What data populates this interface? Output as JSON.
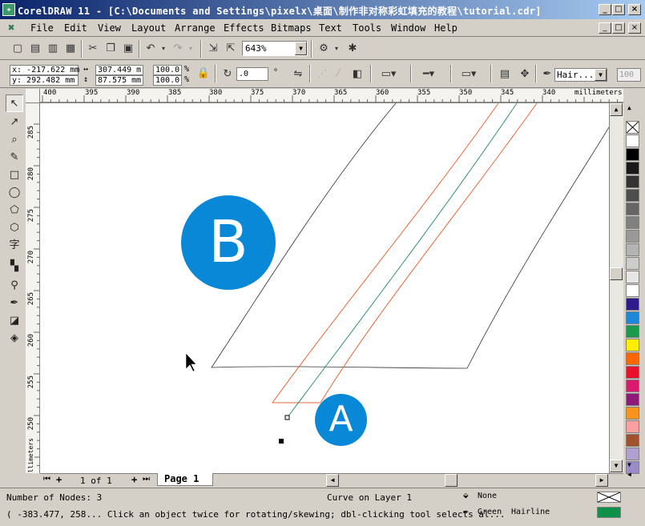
{
  "window": {
    "title": "CorelDRAW 11 - [C:\\Documents and Settings\\pixelx\\桌面\\制作非对称彩虹填充的教程\\tutorial.cdr]",
    "controls": [
      "_",
      "□",
      "×"
    ]
  },
  "menu": [
    "File",
    "Edit",
    "View",
    "Layout",
    "Arrange",
    "Effects",
    "Bitmaps",
    "Text",
    "Tools",
    "Window",
    "Help"
  ],
  "toolbar": {
    "zoom": "643%"
  },
  "propertybar": {
    "x": "x: -217.622 mm",
    "y": "y: 292.482 mm",
    "width": "307.449 m",
    "height": "87.575 mm",
    "scale_x": "100.0",
    "scale_y": "100.0",
    "pct": "%",
    "rotation": ".0",
    "deg": "°",
    "outline_width": "Hair...",
    "smoothness": "100"
  },
  "ruler": {
    "top_ticks": [
      "400",
      "395",
      "390",
      "385",
      "380",
      "375",
      "370",
      "365",
      "360",
      "355",
      "350",
      "345",
      "340"
    ],
    "top_unit": "millimeters",
    "left_ticks": [
      "285",
      "280",
      "275",
      "270",
      "265",
      "260",
      "255",
      "250"
    ],
    "left_unit": "millimeters"
  },
  "markers": {
    "a": "A",
    "b": "B"
  },
  "page_nav": {
    "count": "1 of 1",
    "tab": "Page 1"
  },
  "status": {
    "nodes": "Number of Nodes: 3",
    "object": "Curve on Layer 1",
    "fill_label": "None",
    "outline_color": "Green",
    "outline_width": "Hairline",
    "hint": "( -383.477, 258... Click an object twice for rotating/skewing; dbl-clicking tool selects al..."
  },
  "colors": {
    "accent_marker": "#0a88d8",
    "curve_red": "#e8673a",
    "curve_green": "#2f8f7a",
    "outline_swatch": "#11904a"
  },
  "palette_colors": [
    "#ffffff",
    "#000000",
    "#1a1a1a",
    "#333333",
    "#4d4d4d",
    "#666666",
    "#808080",
    "#999999",
    "#b3b3b3",
    "#cccccc",
    "#e6e6e6",
    "#ffffff",
    "#2e1a8c",
    "#1e88d8",
    "#1a9a4a",
    "#ffee00",
    "#ff6600",
    "#e8102a",
    "#d81b6e",
    "#8e1a7a",
    "#f7941d",
    "#f9a1a1",
    "#a0522d",
    "#b0a0d0",
    "#9a8cc8"
  ]
}
